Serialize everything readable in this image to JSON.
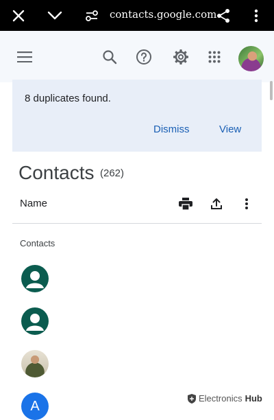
{
  "browser": {
    "url": "contacts.google.com"
  },
  "banner": {
    "message": "8 duplicates found.",
    "dismiss_label": "Dismiss",
    "view_label": "View"
  },
  "page": {
    "title": "Contacts",
    "count": "(262)"
  },
  "list_header": {
    "name_label": "Name"
  },
  "section": {
    "label": "Contacts"
  },
  "contacts": [
    {
      "kind": "default-avatar",
      "color": "#0b5c4f"
    },
    {
      "kind": "default-avatar",
      "color": "#0b5c4f"
    },
    {
      "kind": "photo"
    },
    {
      "kind": "letter",
      "letter": "A",
      "color": "#1a73e8"
    }
  ],
  "watermark": {
    "text_regular": "Electronics",
    "text_bold": "Hub"
  },
  "colors": {
    "accent": "#1a5fb4",
    "banner_bg": "#e8eef8",
    "appbar_bg": "#f5f8fc"
  },
  "icons": [
    "close-icon",
    "chevron-down-icon",
    "tune-icon",
    "share-icon",
    "more-vert-icon",
    "menu-icon",
    "search-icon",
    "help-icon",
    "settings-icon",
    "apps-icon",
    "print-icon",
    "export-icon",
    "more-vert-icon",
    "person-icon"
  ]
}
